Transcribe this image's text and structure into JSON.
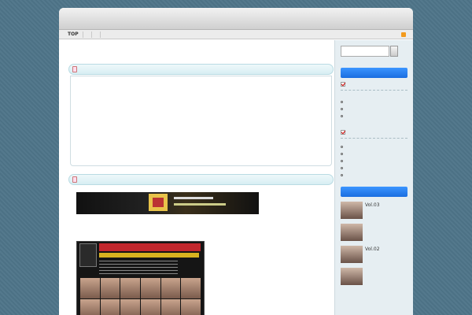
{
  "header": {
    "site_title": "",
    "site_desc": ""
  },
  "nav": {
    "top": "TOP",
    "items": [
      "",
      ""
    ],
    "rss": ""
  },
  "main": {
    "intro": "",
    "post1": {
      "title": "",
      "lines": [
        "",
        "",
        "",
        "",
        ""
      ],
      "red_inline": "",
      "big_red": "",
      "lines2": [
        "",
        ""
      ]
    },
    "post2": {
      "title": "",
      "ad_lines": [
        "",
        "",
        "",
        "",
        "",
        ""
      ],
      "ad_red": [
        "",
        ""
      ]
    }
  },
  "sidebar": {
    "search_placeholder": "",
    "widget_title": "",
    "cat1": "",
    "cat1_items": [
      "",
      "",
      ""
    ],
    "cat2": "",
    "cat2_items": [
      "",
      "",
      "",
      "",
      ""
    ],
    "recent_title": "",
    "recent": [
      {
        "title": "",
        "vol": "Vol.03"
      },
      {
        "title": ""
      },
      {
        "title": "",
        "vol": "Vol.02"
      },
      {
        "title": ""
      }
    ]
  },
  "colors": {
    "accent": "#1a6de0",
    "red": "#e22222",
    "background": "#4e7589"
  }
}
